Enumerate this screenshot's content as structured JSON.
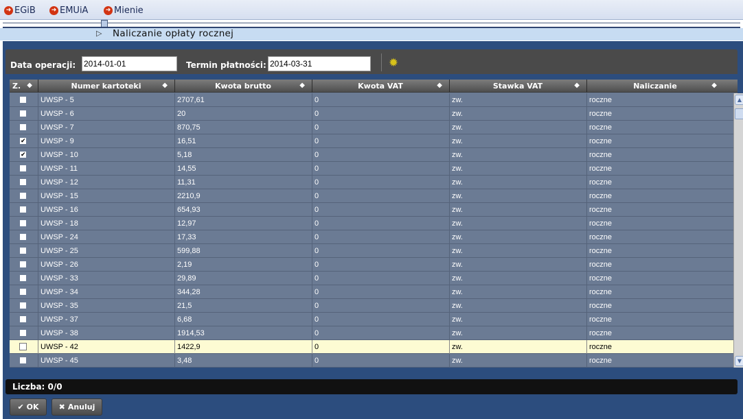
{
  "menu": [
    {
      "label": "EGiB"
    },
    {
      "label": "EMUiA"
    },
    {
      "label": "Mienie"
    }
  ],
  "title": "Naliczanie opłaty rocznej",
  "form": {
    "date_label": "Data operacji:",
    "date_value": "2014-01-01",
    "due_label": "Termin płatności:",
    "due_value": "2014-03-31"
  },
  "grid": {
    "columns": [
      "Z.",
      "Numer kartoteki",
      "Kwota brutto",
      "Kwota VAT",
      "Stawka VAT",
      "Naliczanie"
    ],
    "rows": [
      {
        "checked": false,
        "numer": "UWSP - 5",
        "brutto": "2707,61",
        "vat": "0",
        "stawka": "zw.",
        "naliczanie": "roczne"
      },
      {
        "checked": false,
        "numer": "UWSP - 6",
        "brutto": "20",
        "vat": "0",
        "stawka": "zw.",
        "naliczanie": "roczne"
      },
      {
        "checked": false,
        "numer": "UWSP - 7",
        "brutto": "870,75",
        "vat": "0",
        "stawka": "zw.",
        "naliczanie": "roczne"
      },
      {
        "checked": true,
        "numer": "UWSP - 9",
        "brutto": "16,51",
        "vat": "0",
        "stawka": "zw.",
        "naliczanie": "roczne"
      },
      {
        "checked": true,
        "numer": "UWSP - 10",
        "brutto": "5,18",
        "vat": "0",
        "stawka": "zw.",
        "naliczanie": "roczne"
      },
      {
        "checked": false,
        "numer": "UWSP - 11",
        "brutto": "14,55",
        "vat": "0",
        "stawka": "zw.",
        "naliczanie": "roczne"
      },
      {
        "checked": false,
        "numer": "UWSP - 12",
        "brutto": "11,31",
        "vat": "0",
        "stawka": "zw.",
        "naliczanie": "roczne"
      },
      {
        "checked": false,
        "numer": "UWSP - 15",
        "brutto": "2210,9",
        "vat": "0",
        "stawka": "zw.",
        "naliczanie": "roczne"
      },
      {
        "checked": false,
        "numer": "UWSP - 16",
        "brutto": "654,93",
        "vat": "0",
        "stawka": "zw.",
        "naliczanie": "roczne"
      },
      {
        "checked": false,
        "numer": "UWSP - 18",
        "brutto": "12,97",
        "vat": "0",
        "stawka": "zw.",
        "naliczanie": "roczne"
      },
      {
        "checked": false,
        "numer": "UWSP - 24",
        "brutto": "17,33",
        "vat": "0",
        "stawka": "zw.",
        "naliczanie": "roczne"
      },
      {
        "checked": false,
        "numer": "UWSP - 25",
        "brutto": "599,88",
        "vat": "0",
        "stawka": "zw.",
        "naliczanie": "roczne"
      },
      {
        "checked": false,
        "numer": "UWSP - 26",
        "brutto": "2,19",
        "vat": "0",
        "stawka": "zw.",
        "naliczanie": "roczne"
      },
      {
        "checked": false,
        "numer": "UWSP - 33",
        "brutto": "29,89",
        "vat": "0",
        "stawka": "zw.",
        "naliczanie": "roczne"
      },
      {
        "checked": false,
        "numer": "UWSP - 34",
        "brutto": "344,28",
        "vat": "0",
        "stawka": "zw.",
        "naliczanie": "roczne"
      },
      {
        "checked": false,
        "numer": "UWSP - 35",
        "brutto": "21,5",
        "vat": "0",
        "stawka": "zw.",
        "naliczanie": "roczne"
      },
      {
        "checked": false,
        "numer": "UWSP - 37",
        "brutto": "6,68",
        "vat": "0",
        "stawka": "zw.",
        "naliczanie": "roczne"
      },
      {
        "checked": false,
        "numer": "UWSP - 38",
        "brutto": "1914,53",
        "vat": "0",
        "stawka": "zw.",
        "naliczanie": "roczne"
      },
      {
        "checked": false,
        "numer": "UWSP - 42",
        "brutto": "1422,9",
        "vat": "0",
        "stawka": "zw.",
        "naliczanie": "roczne",
        "selected": true
      },
      {
        "checked": false,
        "numer": "UWSP - 45",
        "brutto": "3,48",
        "vat": "0",
        "stawka": "zw.",
        "naliczanie": "roczne"
      }
    ]
  },
  "footer": {
    "count": "Liczba: 0/0",
    "ok_label": "OK",
    "cancel_label": "Anuluj"
  },
  "colors": {
    "panel": "#2c4d7e",
    "grid_row": "#6b7b94",
    "selected_row": "#fdfbd3",
    "menu_arrow": "#d23413"
  },
  "icons": {
    "menu": "circle-arrow-right-icon",
    "calc": "gear-icon",
    "ok": "check-icon",
    "cancel": "x-icon"
  }
}
